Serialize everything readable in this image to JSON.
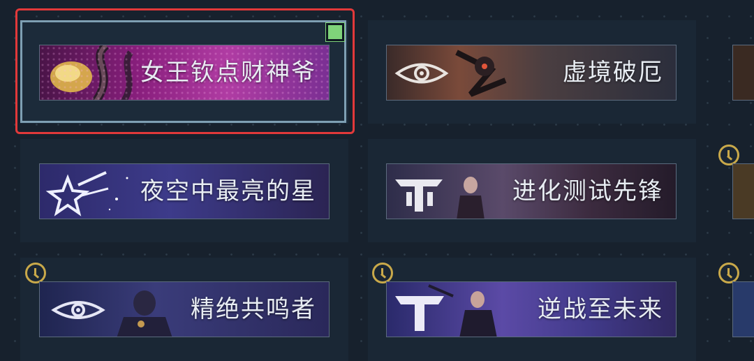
{
  "grid": {
    "items": [
      {
        "title": "女王钦点财神爷",
        "selected": true,
        "timed": false,
        "icon": "golden-snake-art"
      },
      {
        "title": "虚境破厄",
        "selected": false,
        "timed": false,
        "icon": "eye-emblem"
      },
      {
        "title": "夜空中最亮的星",
        "selected": false,
        "timed": false,
        "icon": "shooting-star-emblem"
      },
      {
        "title": "进化测试先锋",
        "selected": false,
        "timed": false,
        "icon": "tt-emblem"
      },
      {
        "title": "精绝共鸣者",
        "selected": false,
        "timed": true,
        "icon": "eye-emblem"
      },
      {
        "title": "逆战至未来",
        "selected": false,
        "timed": true,
        "icon": "t-emblem"
      }
    ]
  },
  "colors": {
    "background": "#17212d",
    "selection_outer": "#e2393a",
    "selection_inner": "#7e9fb3",
    "checkbox": "#7fd37a",
    "timer": "#c9a94a",
    "title_text": "#e8edf3"
  }
}
